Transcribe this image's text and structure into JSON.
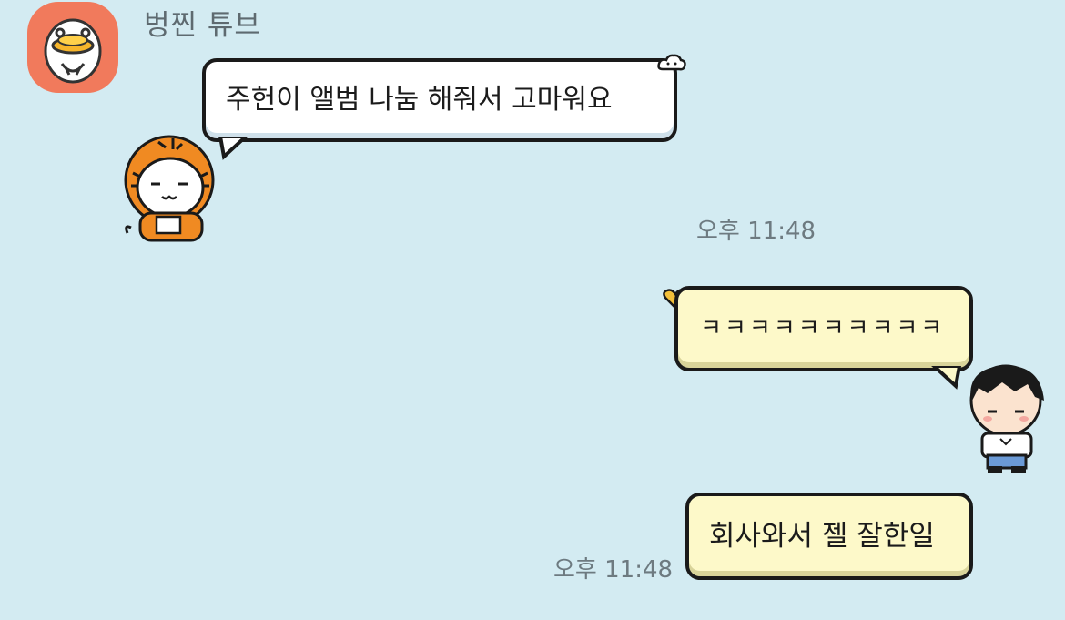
{
  "sender": {
    "name": "벙찐 튜브",
    "avatar_icon": "duck-character-avatar-icon"
  },
  "messages": [
    {
      "direction": "incoming",
      "text": "주헌이 앨범 나눔 해줘서 고마워요",
      "time": "오후 11:48"
    },
    {
      "direction": "outgoing",
      "text": "ㅋㅋㅋㅋㅋㅋㅋㅋㅋㅋ"
    },
    {
      "direction": "outgoing",
      "text": "회사와서 젤 잘한일",
      "time": "오후 11:48"
    }
  ],
  "decorations": {
    "incoming_sticker": "tiger-hoodie-character-icon",
    "outgoing_sticker": "boy-character-icon",
    "bubble_badge_incoming": "cloud-icon",
    "bubble_badge_outgoing": "heart-icon"
  },
  "colors": {
    "background": "#d3ebf2",
    "incoming_bubble": "#ffffff",
    "outgoing_bubble": "#fdf9c9",
    "avatar_bg": "#f17a5c"
  }
}
